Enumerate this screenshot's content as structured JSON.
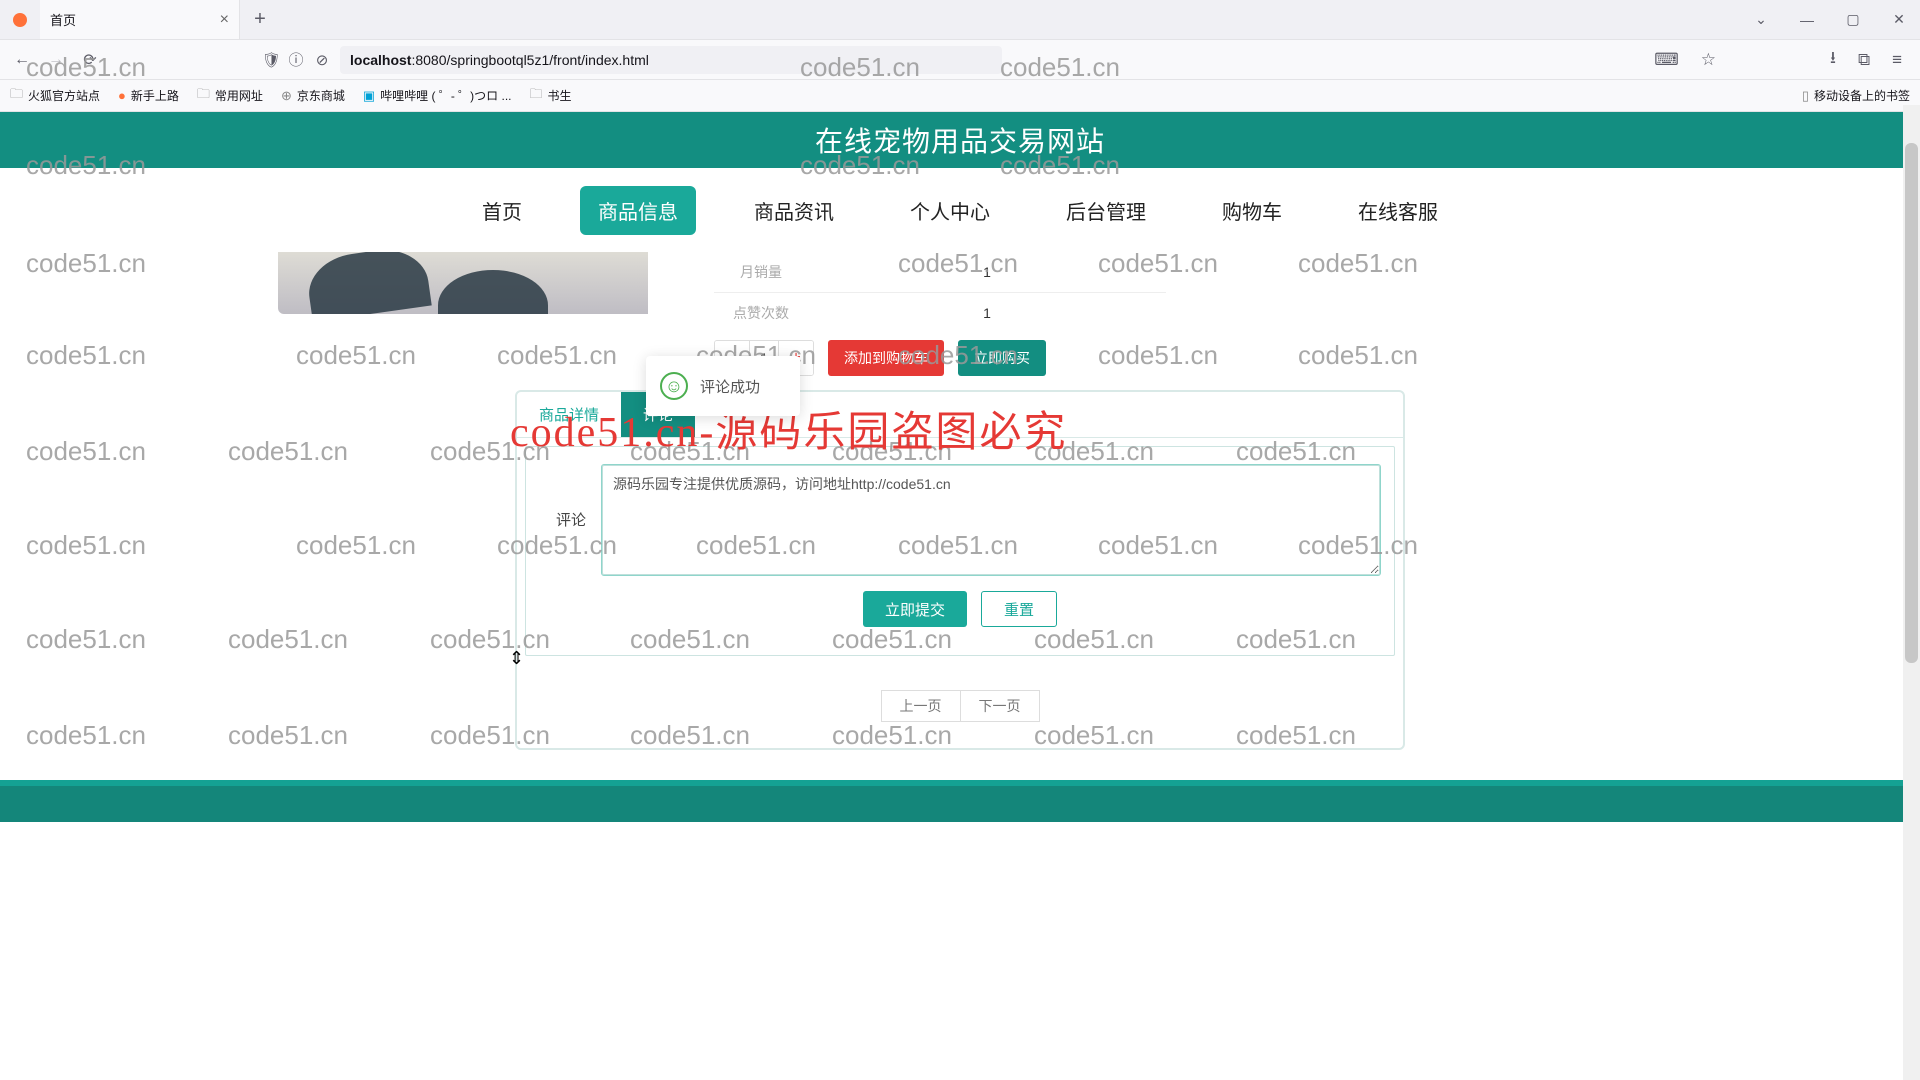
{
  "browser": {
    "tab_title": "首页",
    "url_host": "localhost",
    "url_port": ":8080",
    "url_path": "/springbootql5z1/front/index.html",
    "bookmarks": [
      "火狐官方站点",
      "新手上路",
      "常用网址",
      "京东商城",
      "哔哩哔哩 (  ゜- ゜)つロ ...",
      "书生"
    ],
    "mobile_bm": "移动设备上的书签"
  },
  "site": {
    "title": "在线宠物用品交易网站",
    "nav": [
      "首页",
      "商品信息",
      "商品资讯",
      "个人中心",
      "后台管理",
      "购物车",
      "在线客服"
    ],
    "nav_active_index": 1
  },
  "product": {
    "rows": [
      {
        "label": "月销量",
        "value": "1"
      },
      {
        "label": "点赞次数",
        "value": "1"
      }
    ],
    "qty": "1",
    "add_cart": "添加到购物车",
    "buy_now": "立即购买"
  },
  "detail": {
    "tabs": [
      "商品详情",
      "评论"
    ],
    "active_tab_index": 1,
    "comment_label": "评论",
    "comment_value": "源码乐园专注提供优质源码，访问地址http://code51.cn",
    "submit": "立即提交",
    "reset": "重置",
    "prev": "上一页",
    "next": "下一页"
  },
  "toast": {
    "msg": "评论成功"
  },
  "watermark": {
    "text": "code51.cn",
    "banner": "code51.cn-源码乐园盗图必究"
  }
}
